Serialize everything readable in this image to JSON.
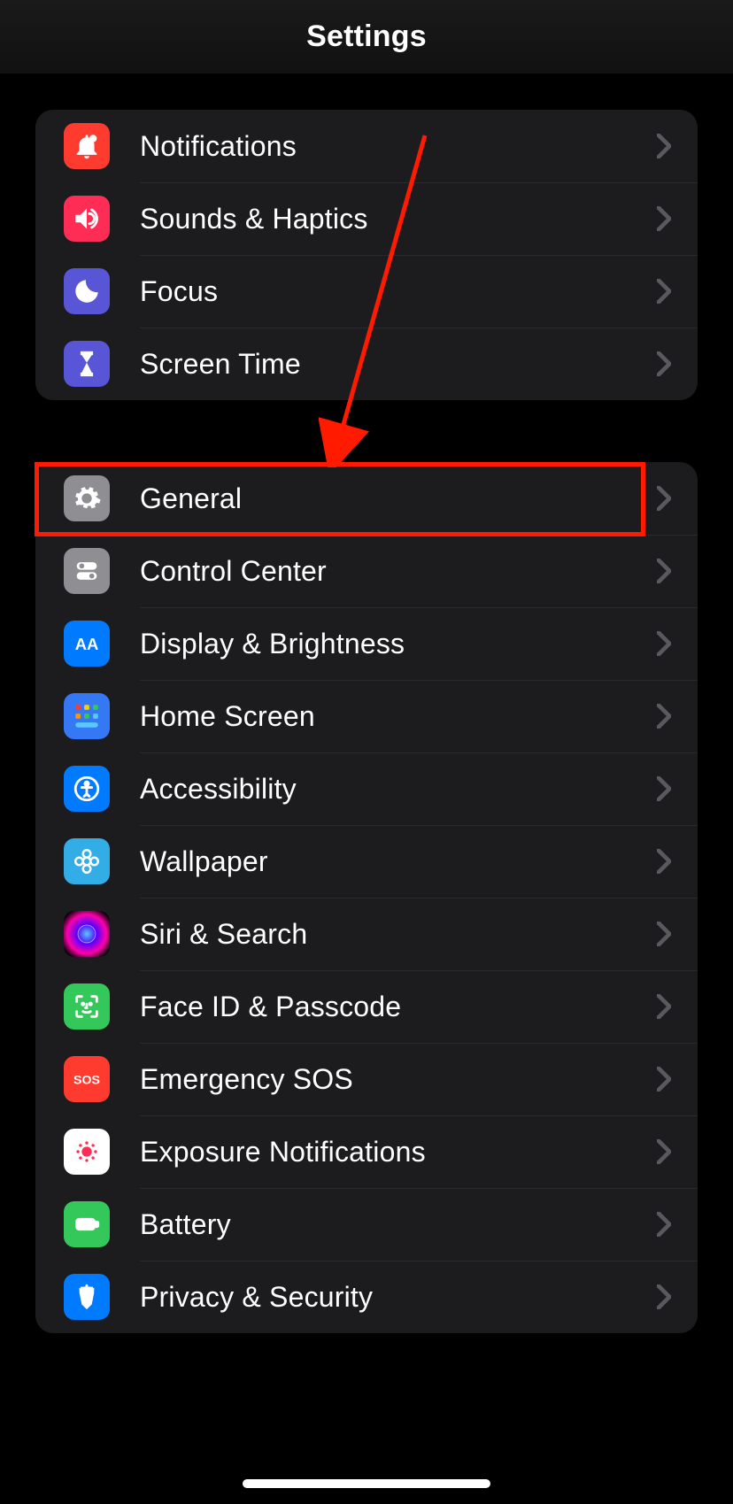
{
  "header": {
    "title": "Settings"
  },
  "group1": {
    "items": [
      {
        "label": "Notifications"
      },
      {
        "label": "Sounds & Haptics"
      },
      {
        "label": "Focus"
      },
      {
        "label": "Screen Time"
      }
    ]
  },
  "group2": {
    "items": [
      {
        "label": "General"
      },
      {
        "label": "Control Center"
      },
      {
        "label": "Display & Brightness"
      },
      {
        "label": "Home Screen"
      },
      {
        "label": "Accessibility"
      },
      {
        "label": "Wallpaper"
      },
      {
        "label": "Siri & Search"
      },
      {
        "label": "Face ID & Passcode"
      },
      {
        "label": "Emergency SOS"
      },
      {
        "label": "Exposure Notifications"
      },
      {
        "label": "Battery"
      },
      {
        "label": "Privacy & Security"
      }
    ]
  },
  "annotation": {
    "highlight_target": "General",
    "arrow_color": "#ff1a00"
  }
}
